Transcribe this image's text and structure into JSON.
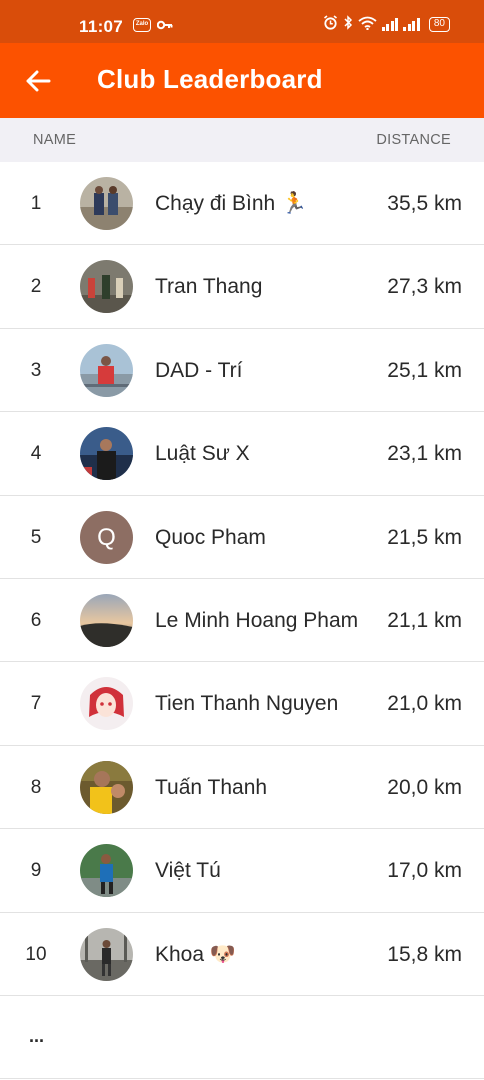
{
  "status_bar": {
    "time": "11:07",
    "left_icons": [
      "zalo-icon",
      "key-icon"
    ],
    "right_icons": [
      "alarm-icon",
      "bluetooth-icon",
      "wifi-icon",
      "signal-icon",
      "signal-icon"
    ],
    "zalo_label": "Zalo",
    "battery": "80"
  },
  "header": {
    "title": "Club Leaderboard",
    "back_icon": "arrow-left-icon",
    "color": "#fc5200"
  },
  "columns": {
    "name": "NAME",
    "distance": "DISTANCE"
  },
  "leaderboard": [
    {
      "rank": "1",
      "name": "Chạy đi Bình 🏃",
      "distance": "35,5 km"
    },
    {
      "rank": "2",
      "name": "Tran Thang",
      "distance": "27,3 km"
    },
    {
      "rank": "3",
      "name": "DAD - Trí",
      "distance": "25,1 km"
    },
    {
      "rank": "4",
      "name": "Luật Sư X",
      "distance": "23,1 km"
    },
    {
      "rank": "5",
      "name": "Quoc Pham",
      "distance": "21,5 km",
      "avatar_letter": "Q"
    },
    {
      "rank": "6",
      "name": "Le Minh Hoang Pham",
      "distance": "21,1 km"
    },
    {
      "rank": "7",
      "name": "Tien Thanh Nguyen",
      "distance": "21,0 km"
    },
    {
      "rank": "8",
      "name": "Tuấn Thanh",
      "distance": "20,0 km"
    },
    {
      "rank": "9",
      "name": "Việt Tú",
      "distance": "17,0 km"
    },
    {
      "rank": "10",
      "name": "Khoa 🐶",
      "distance": "15,8 km"
    }
  ],
  "more": "..."
}
